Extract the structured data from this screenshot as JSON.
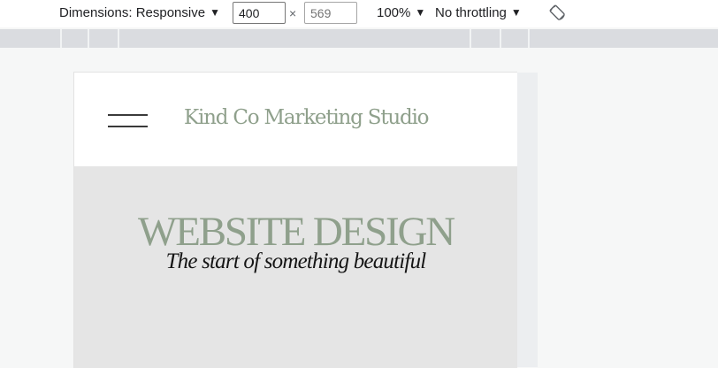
{
  "toolbar": {
    "dimensions_label": "Dimensions: Responsive",
    "width_value": "400",
    "height_placeholder": "569",
    "times_symbol": "×",
    "zoom_label": "100%",
    "throttling_label": "No throttling",
    "caret": "▼",
    "rotate_icon": "rotate-icon"
  },
  "site": {
    "title": "Kind Co Marketing Studio",
    "menu_icon": "hamburger-icon"
  },
  "hero": {
    "title": "WEBSITE DESIGN",
    "subtitle": "The start of something beautiful"
  },
  "colors": {
    "brand_sage": "#8fa08c",
    "hero_background": "#e5e5e5",
    "toolbar_background": "#ffffff",
    "ruler_background": "#dadce0"
  }
}
